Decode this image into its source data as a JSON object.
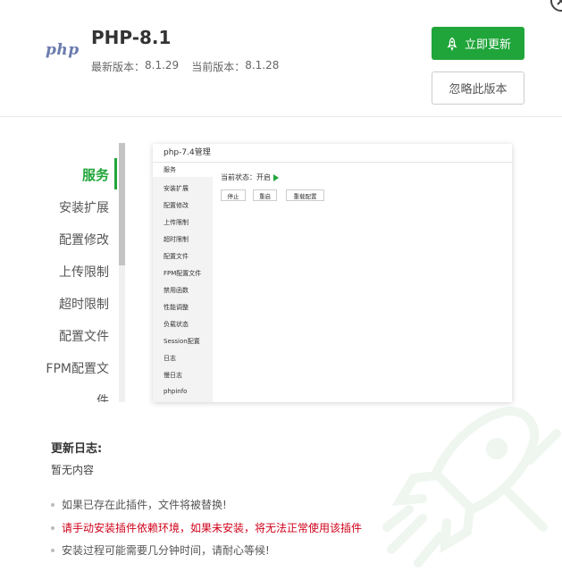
{
  "header": {
    "logo_text": "php",
    "name": "PHP-8.1",
    "latest_label": "最新版本：",
    "latest_version": "8.1.29",
    "current_label": "当前版本：",
    "current_version": "8.1.28",
    "update_label": "立即更新",
    "ignore_label": "忽略此版本"
  },
  "menu": {
    "items": [
      "服务",
      "安装扩展",
      "配置修改",
      "上传限制",
      "超时限制",
      "配置文件",
      "FPM配置文",
      "件"
    ],
    "active_index": 0
  },
  "preview": {
    "title": "php-7.4管理",
    "items": [
      "服务",
      "安装扩展",
      "配置修改",
      "上传限制",
      "超时限制",
      "配置文件",
      "FPM配置文件",
      "禁用函数",
      "性能调整",
      "负载状态",
      "Session配置",
      "日志",
      "慢日志",
      "phpinfo"
    ],
    "status_text": "当前状态：开启",
    "buttons": [
      "停止",
      "重启",
      "重载配置"
    ]
  },
  "changelog": {
    "title": "更新日志:",
    "body": "暂无内容"
  },
  "notes": [
    "如果已存在此插件，文件将被替换!",
    "请手动安装插件依赖环境，如果未安装，将无法正常使用该插件",
    "安装过程可能需要几分钟时间，请耐心等候!"
  ],
  "colors": {
    "accent": "#20a53a",
    "warning": "#d0021b",
    "logo": "#6a7bad"
  }
}
